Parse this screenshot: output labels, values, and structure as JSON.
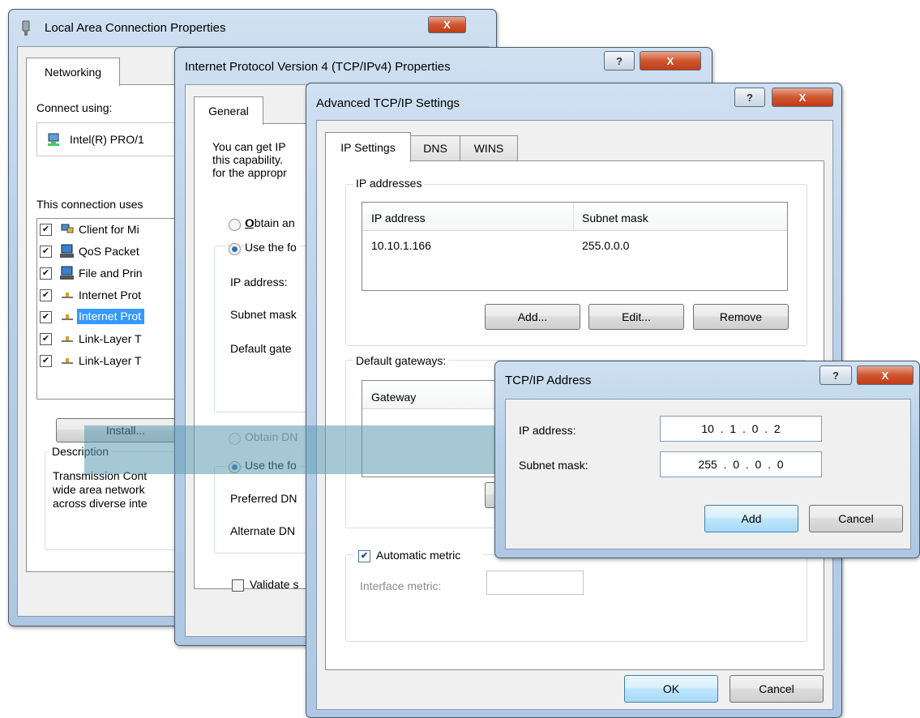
{
  "win1": {
    "title": "Local Area Connection Properties",
    "tab": "Networking",
    "connect_using_label": "Connect using:",
    "adapter": "Intel(R) PRO/1",
    "uses_label": "This connection uses",
    "items": [
      {
        "label": "Client for Mi",
        "checked": true,
        "selected": false
      },
      {
        "label": "QoS Packet",
        "checked": true,
        "selected": false
      },
      {
        "label": "File and Prin",
        "checked": true,
        "selected": false
      },
      {
        "label": "Internet Prot",
        "checked": true,
        "selected": false
      },
      {
        "label": "Internet Prot",
        "checked": true,
        "selected": true
      },
      {
        "label": "Link-Layer T",
        "checked": true,
        "selected": false
      },
      {
        "label": "Link-Layer T",
        "checked": true,
        "selected": false
      }
    ],
    "install_button": "Install...",
    "description_label": "Description",
    "description_lines": [
      "Transmission Cont",
      "wide area network",
      "across diverse inte"
    ],
    "close": "X"
  },
  "win2": {
    "title": "Internet Protocol Version 4 (TCP/IPv4) Properties",
    "tab": "General",
    "intro_lines": [
      "You can get IP",
      "this capability.",
      "for the appropr"
    ],
    "obtain_ip": "Obtain an",
    "use_following_ip": "Use the fo",
    "ip_address": "IP address:",
    "subnet_mask": "Subnet mask",
    "default_gateway": "Default gate",
    "obtain_dns": "Obtain DN",
    "use_following_dns": "Use the fo",
    "preferred_dns": "Preferred DN",
    "alternate_dns": "Alternate DN",
    "validate": "Validate s",
    "help": "?",
    "close": "X"
  },
  "win3": {
    "title": "Advanced TCP/IP Settings",
    "tabs": [
      "IP Settings",
      "DNS",
      "WINS"
    ],
    "ip_addresses_group": "IP addresses",
    "columns": [
      "IP address",
      "Subnet mask"
    ],
    "rows": [
      [
        "10.10.1.166",
        "255.0.0.0"
      ]
    ],
    "add_button": "Add...",
    "edit_button": "Edit...",
    "remove_button": "Remove",
    "gateways_group": "Default gateways:",
    "gateway_column": "Gateway",
    "auto_metric": "Automatic metric",
    "auto_metric_checked": true,
    "interface_metric": "Interface metric:",
    "ok_button": "OK",
    "cancel_button": "Cancel",
    "help": "?",
    "close": "X"
  },
  "win4": {
    "title": "TCP/IP Address",
    "ip_label": "IP address:",
    "ip_value": "10  .  1  .  0  .  2",
    "mask_label": "Subnet mask:",
    "mask_value": "255  .  0  .  0  .  0",
    "add_button": "Add",
    "cancel_button": "Cancel",
    "help": "?",
    "close": "X"
  },
  "colors": {
    "frame": "#b9d1ea",
    "selection": "#3399ff",
    "arrow": "#5b9bb0"
  }
}
